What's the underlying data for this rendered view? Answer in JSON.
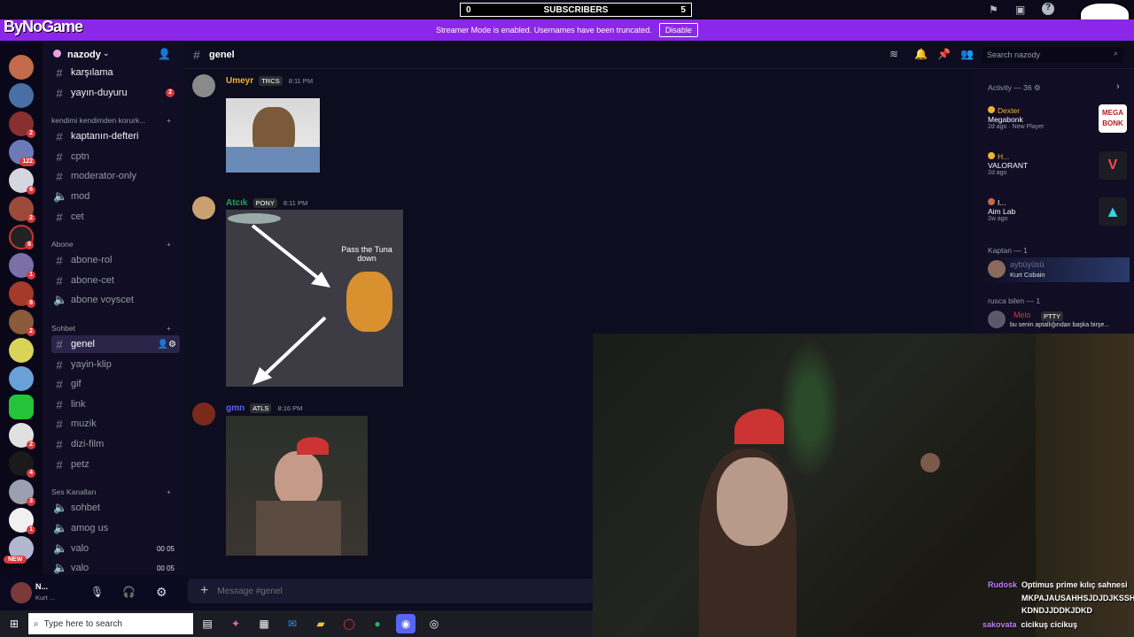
{
  "overlay": {
    "subs_left": "0",
    "subs_label": "SUBSCRIBERS",
    "subs_right": "5",
    "logo": "ByNoGame"
  },
  "streamer_bar": {
    "text": "Streamer Mode is enabled. Usernames have been truncated.",
    "button": "Disable"
  },
  "server": {
    "name": "nazody"
  },
  "rail_badges": [
    "2",
    "122",
    "6",
    "2",
    "8",
    "1",
    "8",
    "2",
    "2",
    "4",
    "3",
    "1"
  ],
  "rail_new": "NEW",
  "channels": [
    {
      "name": "karşılama",
      "bright": true
    },
    {
      "name": "yayın-duyuru",
      "bright": true,
      "badge": "2"
    }
  ],
  "categories": {
    "c1": "kendimi kendimden korurk...",
    "c2": "Abone",
    "c3": "Sohbet",
    "c4": "Ses Kanalları"
  },
  "cat1": [
    "kaptanın-defteri",
    "cptn",
    "moderator-only",
    "mod",
    "cet"
  ],
  "cat2": [
    "abone-rol",
    "abone-cet",
    "abone voyscet"
  ],
  "cat3": [
    "genel",
    "yayin-klip",
    "gif",
    "link",
    "muzik",
    "dizi-film",
    "petz"
  ],
  "voice": [
    {
      "name": "sohbet"
    },
    {
      "name": "amog us"
    },
    {
      "name": "valo",
      "a": "00",
      "b": "05"
    },
    {
      "name": "valo",
      "a": "00",
      "b": "05"
    }
  ],
  "user": {
    "name": "N...",
    "status": "Kurt ..."
  },
  "chat": {
    "channel": "genel",
    "search": "Search nazody",
    "input_placeholder": "Message #genel"
  },
  "messages": [
    {
      "author": "Umeyr",
      "tag": "TRCS",
      "time": "8:11 PM",
      "color": "#f0b232"
    },
    {
      "author": "Atcık",
      "tag": "PONY",
      "time": "8:11 PM",
      "color": "#23a559",
      "meme_text": "Pass the Tuna down"
    },
    {
      "author": "gmn",
      "tag": "ATLS",
      "time": "8:16 PM",
      "color": "#5865f2"
    }
  ],
  "activity": {
    "header": "Activity — 36",
    "items": [
      {
        "user": "Dexter",
        "game": "Megabonk",
        "time": "2d ago",
        "extra": "New Player",
        "icon_text": "MEGA BONK"
      },
      {
        "user": "H...",
        "game": "VALORANT",
        "time": "2d ago"
      },
      {
        "user": "I...",
        "game": "Aim Lab",
        "time": "2w ago"
      }
    ]
  },
  "members": {
    "kaptan_header": "Kaptan — 1",
    "kaptan_name": "aybüyüsü",
    "kaptan_status": "Kurt Cobain",
    "rusca_header": "rusca bilen — 1",
    "rusca_name": "Melo",
    "rusca_tag": "PTTY",
    "rusca_status": "bu senin aptallığından başka birşe..."
  },
  "stream_chat": [
    {
      "user": "Rudosk",
      "text": "Optimus prime kılıç sahnesi"
    },
    {
      "user": "",
      "text": "MKPAJAUSAHHSJDJDJKSSH"
    },
    {
      "user": "",
      "text": "KDNDJJDDKJDKD"
    },
    {
      "user": "sakovata",
      "text": "cicikuş cicikuş"
    }
  ],
  "taskbar": {
    "search": "Type here to search"
  }
}
